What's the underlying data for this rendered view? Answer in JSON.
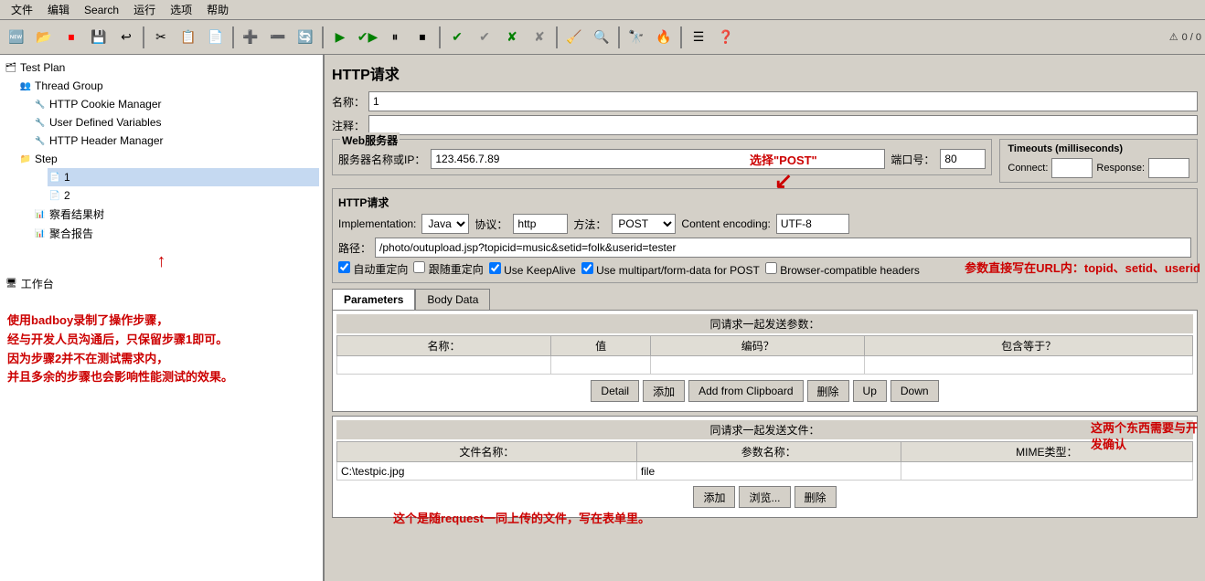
{
  "menubar": {
    "items": [
      "文件",
      "编辑",
      "Search",
      "运行",
      "选项",
      "帮助"
    ]
  },
  "toolbar": {
    "status": "0 / 0",
    "warning_icon": "⚠"
  },
  "tree": {
    "items": [
      {
        "label": "Test Plan",
        "indent": 0,
        "icon": "📋"
      },
      {
        "label": "Thread Group",
        "indent": 1,
        "icon": "👥"
      },
      {
        "label": "HTTP Cookie Manager",
        "indent": 2,
        "icon": "🔧"
      },
      {
        "label": "User Defined Variables",
        "indent": 2,
        "icon": "🔧"
      },
      {
        "label": "HTTP Header Manager",
        "indent": 2,
        "icon": "🔧"
      },
      {
        "label": "Step",
        "indent": 1,
        "icon": "📁"
      },
      {
        "label": "1",
        "indent": 3,
        "icon": "📄"
      },
      {
        "label": "2",
        "indent": 3,
        "icon": "📄"
      },
      {
        "label": "察看结果树",
        "indent": 2,
        "icon": "📊"
      },
      {
        "label": "聚合报告",
        "indent": 2,
        "icon": "📊"
      }
    ]
  },
  "workbench": {
    "label": "工作台"
  },
  "left_annotations": {
    "lines": [
      "使用badboy录制了操作步骤，",
      "经与开发人员沟通后，只保留步骤1即可。",
      "因为步骤2并不在测试需求内，",
      "并且多余的步骤也会影响性能测试的效果。"
    ]
  },
  "right_annotations": {
    "post_label": "选择\"POST\"",
    "param_label": "参数直接写在URL内：topid、setid、userid",
    "confirm_label": "这两个东西需要与开\n发确认",
    "file_label": "这个是随request一同上传的文件，写在表单里。"
  },
  "http_request": {
    "title": "HTTP请求",
    "name_label": "名称：",
    "name_value": "1",
    "comment_label": "注释：",
    "comment_value": "",
    "web_server_label": "Web服务器",
    "server_label": "服务器名称或IP：",
    "server_value": "123.456.7.89",
    "port_label": "端口号：",
    "port_value": "80",
    "timeout_title": "Timeouts (milliseconds)",
    "connect_label": "Connect:",
    "connect_value": "",
    "response_label": "Response:",
    "response_value": "",
    "http_request_label": "HTTP请求",
    "impl_label": "Implementation:",
    "impl_value": "Java",
    "protocol_label": "协议：",
    "protocol_value": "http",
    "method_label": "方法：",
    "method_value": "POST",
    "encoding_label": "Content encoding:",
    "encoding_value": "UTF-8",
    "path_label": "路径：",
    "path_value": "/photo/outupload.jsp?topicid=music&setid=folk&userid=tester",
    "checkboxes": [
      {
        "label": "自动重定向",
        "checked": true
      },
      {
        "label": "跟随重定向",
        "checked": false
      },
      {
        "label": "Use KeepAlive",
        "checked": true
      },
      {
        "label": "Use multipart/form-data for POST",
        "checked": true
      },
      {
        "label": "Browser-compatible headers",
        "checked": false
      }
    ],
    "tabs": [
      {
        "label": "Parameters",
        "active": true
      },
      {
        "label": "Body Data",
        "active": false
      }
    ],
    "params_header": "同请求一起发送参数：",
    "params_columns": [
      "名称：",
      "值",
      "编码？",
      "包含等于？"
    ],
    "params_buttons": [
      "Detail",
      "添加",
      "Add from Clipboard",
      "删除",
      "Up",
      "Down"
    ],
    "files_header": "同请求一起发送文件：",
    "files_columns": [
      "文件名称：",
      "参数名称：",
      "MIME类型："
    ],
    "files_rows": [
      {
        "filename": "C:\\testpic.jpg",
        "paramname": "file",
        "mimetype": ""
      }
    ],
    "files_buttons": [
      "添加",
      "浏览...",
      "删除"
    ]
  }
}
